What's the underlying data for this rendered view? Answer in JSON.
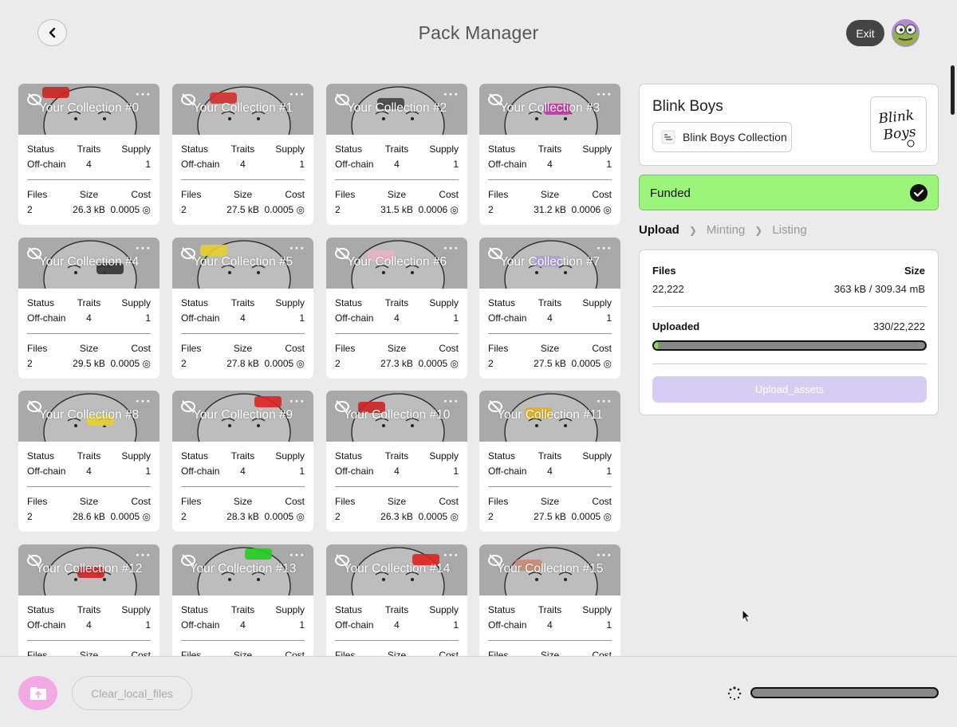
{
  "header": {
    "title": "Pack Manager",
    "exit_label": "Exit"
  },
  "card_labels": {
    "status": "Status",
    "traits": "Traits",
    "supply": "Supply",
    "files": "Files",
    "size": "Size",
    "cost": "Cost"
  },
  "cards": [
    {
      "title": "Your Collection #0",
      "status": "Off-chain",
      "traits": "4",
      "supply": "1",
      "files": "2",
      "size": "26.3 kB",
      "cost": "0.0005 ◎"
    },
    {
      "title": "Your Collection #1",
      "status": "Off-chain",
      "traits": "4",
      "supply": "1",
      "files": "2",
      "size": "27.5 kB",
      "cost": "0.0005 ◎"
    },
    {
      "title": "Your Collection #2",
      "status": "Off-chain",
      "traits": "4",
      "supply": "1",
      "files": "2",
      "size": "31.5 kB",
      "cost": "0.0006 ◎"
    },
    {
      "title": "Your Collection #3",
      "status": "Off-chain",
      "traits": "4",
      "supply": "1",
      "files": "2",
      "size": "31.2 kB",
      "cost": "0.0006 ◎"
    },
    {
      "title": "Your Collection #4",
      "status": "Off-chain",
      "traits": "4",
      "supply": "1",
      "files": "2",
      "size": "29.5 kB",
      "cost": "0.0005 ◎"
    },
    {
      "title": "Your Collection #5",
      "status": "Off-chain",
      "traits": "4",
      "supply": "1",
      "files": "2",
      "size": "27.8 kB",
      "cost": "0.0005 ◎"
    },
    {
      "title": "Your Collection #6",
      "status": "Off-chain",
      "traits": "4",
      "supply": "1",
      "files": "2",
      "size": "27.3 kB",
      "cost": "0.0005 ◎"
    },
    {
      "title": "Your Collection #7",
      "status": "Off-chain",
      "traits": "4",
      "supply": "1",
      "files": "2",
      "size": "27.5 kB",
      "cost": "0.0005 ◎"
    },
    {
      "title": "Your Collection #8",
      "status": "Off-chain",
      "traits": "4",
      "supply": "1",
      "files": "2",
      "size": "28.6 kB",
      "cost": "0.0005 ◎"
    },
    {
      "title": "Your Collection #9",
      "status": "Off-chain",
      "traits": "4",
      "supply": "1",
      "files": "2",
      "size": "28.3 kB",
      "cost": "0.0005 ◎"
    },
    {
      "title": "Your Collection #10",
      "status": "Off-chain",
      "traits": "4",
      "supply": "1",
      "files": "2",
      "size": "26.3 kB",
      "cost": "0.0005 ◎"
    },
    {
      "title": "Your Collection #11",
      "status": "Off-chain",
      "traits": "4",
      "supply": "1",
      "files": "2",
      "size": "27.5 kB",
      "cost": "0.0005 ◎"
    },
    {
      "title": "Your Collection #12",
      "status": "Off-chain",
      "traits": "4",
      "supply": "1",
      "files": "",
      "size": "",
      "cost": ""
    },
    {
      "title": "Your Collection #13",
      "status": "Off-chain",
      "traits": "4",
      "supply": "1",
      "files": "",
      "size": "",
      "cost": ""
    },
    {
      "title": "Your Collection #14",
      "status": "Off-chain",
      "traits": "4",
      "supply": "1",
      "files": "",
      "size": "",
      "cost": ""
    },
    {
      "title": "Your Collection #15",
      "status": "Off-chain",
      "traits": "4",
      "supply": "1",
      "files": "",
      "size": "",
      "cost": ""
    }
  ],
  "card_accents": [
    "#cc2222",
    "#d32f2f",
    "#444444",
    "#cc33aa",
    "#333333",
    "#e5cf2e",
    "#e8b4c0",
    "#b0a0e0",
    "#e5d030",
    "#dd2222",
    "#cc2222",
    "#e8b020",
    "#cc2222",
    "#22cc22",
    "#dd2222",
    "#c98a70"
  ],
  "collection": {
    "name": "Blink Boys",
    "chip_label": "Blink Boys Collection",
    "logo_line1": "Blink",
    "logo_line2": "Boys"
  },
  "funded": {
    "label": "Funded",
    "color": "#9bf57a"
  },
  "steps": [
    {
      "label": "Upload",
      "active": true
    },
    {
      "label": "Minting",
      "active": false
    },
    {
      "label": "Listing",
      "active": false
    }
  ],
  "upload": {
    "files_label": "Files",
    "size_label": "Size",
    "files_value": "22,222",
    "size_value": "363 kB / 309.34 mB",
    "uploaded_label": "Uploaded",
    "uploaded_value": "330/22,222",
    "progress_fraction": 0.015,
    "button_label": "Upload_assets"
  },
  "footer": {
    "clear_label": "Clear_local_files",
    "progress_fraction": 0.0
  }
}
